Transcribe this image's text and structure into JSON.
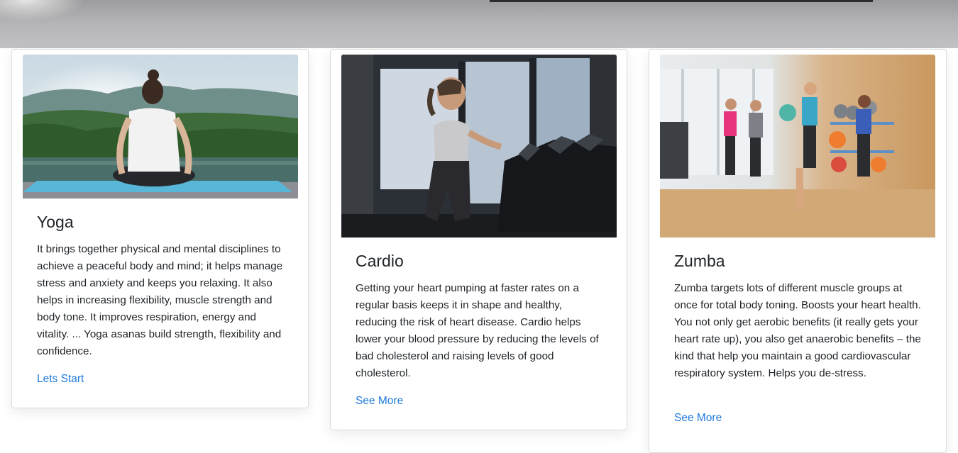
{
  "cards": [
    {
      "title": "Yoga",
      "text": "It brings together physical and mental disciplines to achieve a peaceful body and mind; it helps manage stress and anxiety and keeps you relaxing. It also helps in increasing flexibility, muscle strength and body tone. It improves respiration, energy and vitality. ... Yoga asanas build strength, flexibility and confidence.",
      "link": "Lets Start"
    },
    {
      "title": "Cardio",
      "text": "Getting your heart pumping at faster rates on a regular basis keeps it in shape and healthy, reducing the risk of heart disease. Cardio helps lower your blood pressure by reducing the levels of bad cholesterol and raising levels of good cholesterol.",
      "link": "See More"
    },
    {
      "title": "Zumba",
      "text": "Zumba targets lots of different muscle groups at once for total body toning. Boosts your heart health. You not only get aerobic benefits (it really gets your heart rate up), you also get anaerobic benefits – the kind that help you maintain a good cardiovascular respiratory system. Helps you de-stress.",
      "link": "See More"
    }
  ],
  "colors": {
    "link": "#1f7ae0",
    "text": "#212529"
  }
}
